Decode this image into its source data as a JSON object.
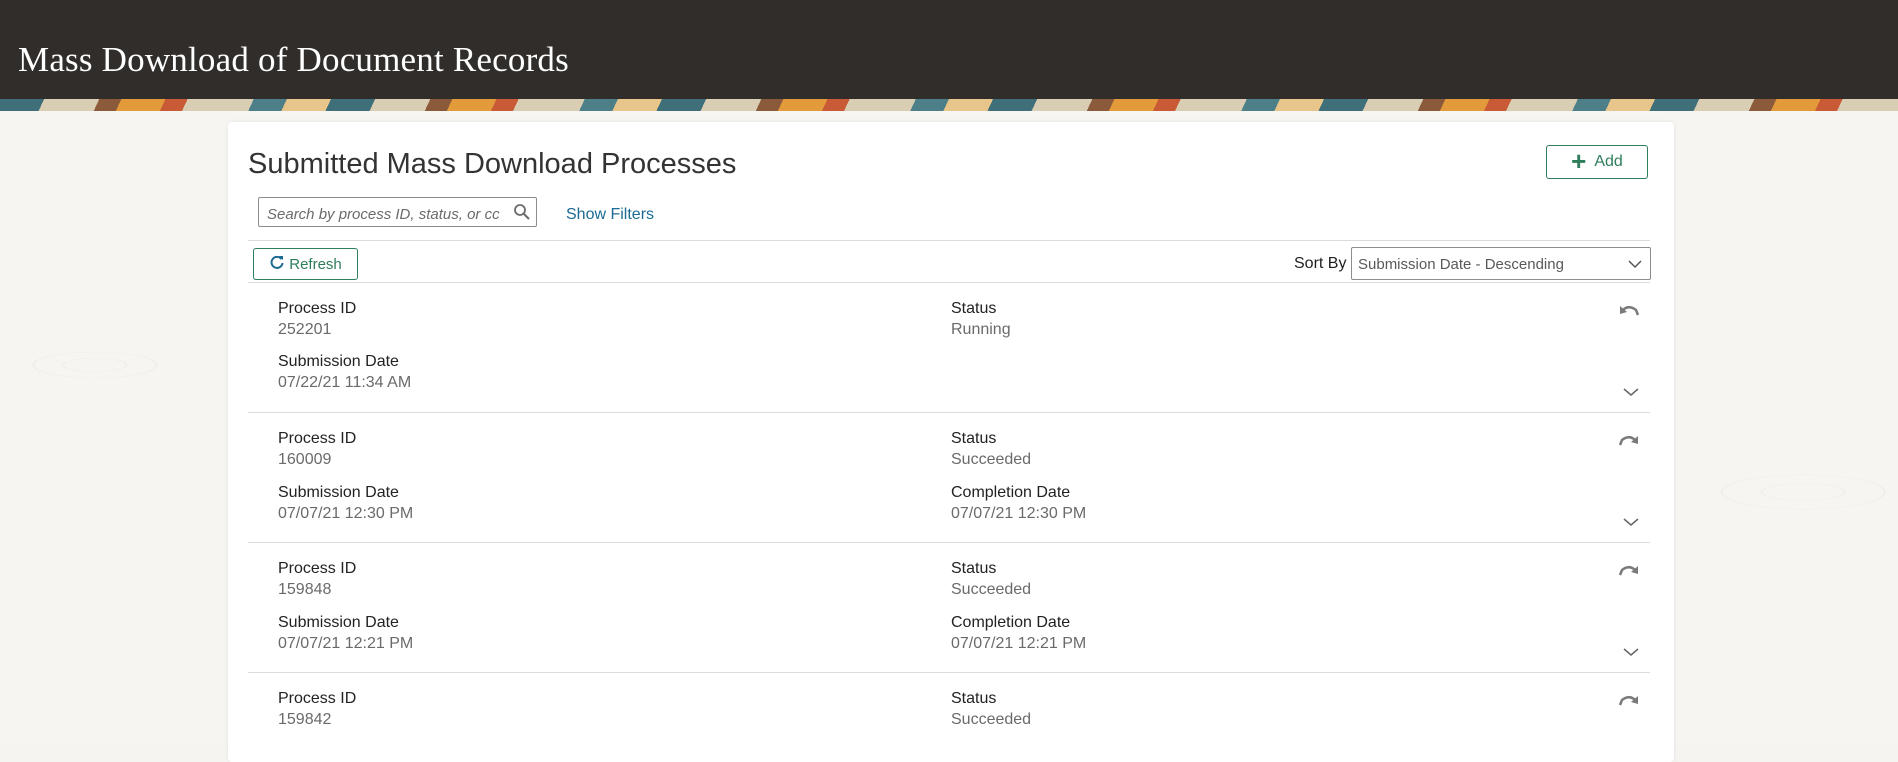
{
  "page": {
    "title": "Mass Download of Document Records"
  },
  "panel": {
    "heading": "Submitted Mass Download Processes",
    "add_label": "Add",
    "search_placeholder": "Search by process ID, status, or cc",
    "show_filters_label": "Show Filters",
    "refresh_label": "Refresh",
    "sort_label": "Sort By",
    "sort_value": "Submission Date - Descending"
  },
  "labels": {
    "process_id": "Process ID",
    "status": "Status",
    "submission_date": "Submission Date",
    "completion_date": "Completion Date"
  },
  "processes": [
    {
      "id": "252201",
      "status": "Running",
      "submission_date": "07/22/21 11:34 AM",
      "completion_date": "",
      "action_icon": "undo-icon"
    },
    {
      "id": "160009",
      "status": "Succeeded",
      "submission_date": "07/07/21 12:30 PM",
      "completion_date": "07/07/21 12:30 PM",
      "action_icon": "redo-icon"
    },
    {
      "id": "159848",
      "status": "Succeeded",
      "submission_date": "07/07/21 12:21 PM",
      "completion_date": "07/07/21 12:21 PM",
      "action_icon": "redo-icon"
    },
    {
      "id": "159842",
      "status": "Succeeded",
      "submission_date": "",
      "completion_date": "",
      "action_icon": "redo-icon"
    }
  ],
  "colors": {
    "header_bg": "#312d2a",
    "accent_green": "#2e7d5b",
    "link_blue": "#1b6b93"
  }
}
